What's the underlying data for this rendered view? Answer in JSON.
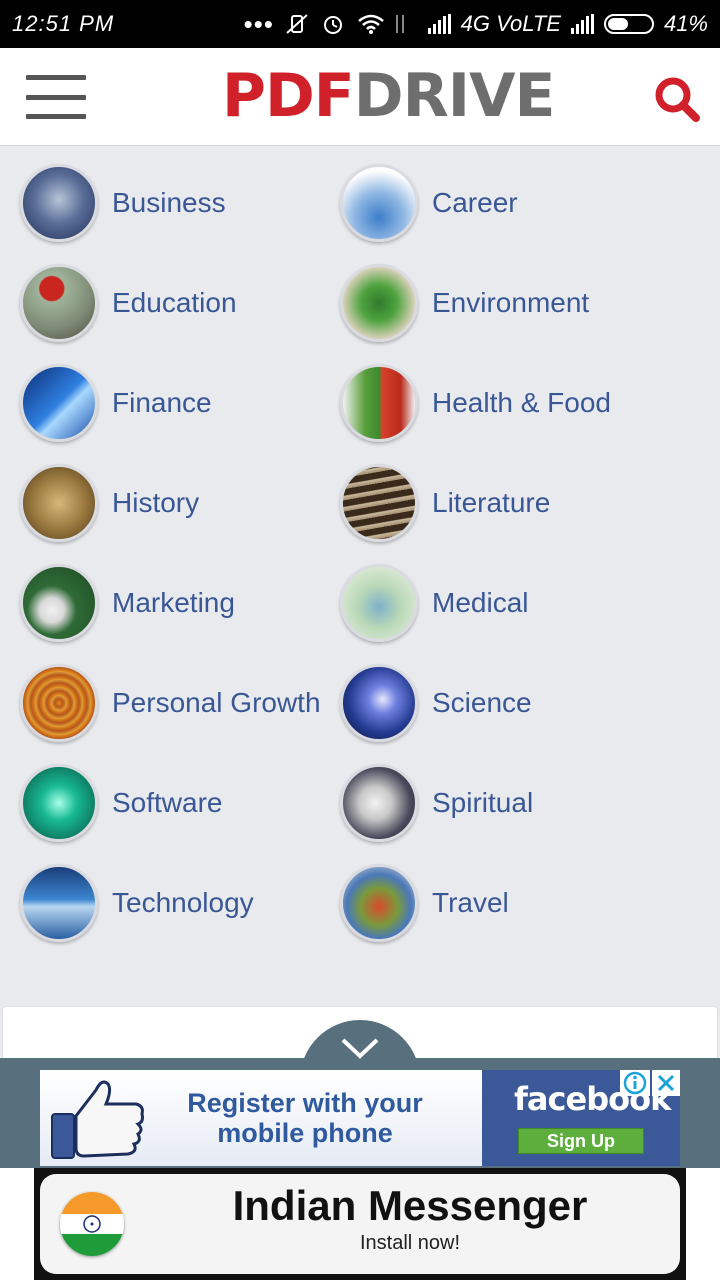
{
  "status_bar": {
    "time": "12:51 PM",
    "network": "4G VoLTE",
    "battery": "41%"
  },
  "header": {
    "logo_part1": "PDF",
    "logo_part2": "DRIVE",
    "menu_icon": "hamburger-menu-icon",
    "search_icon": "search-icon",
    "logo_red": "#d0202a",
    "logo_gray": "#6e6e6e"
  },
  "categories": [
    {
      "label": "Business"
    },
    {
      "label": "Career"
    },
    {
      "label": "Education"
    },
    {
      "label": "Environment"
    },
    {
      "label": "Finance"
    },
    {
      "label": "Health & Food"
    },
    {
      "label": "History"
    },
    {
      "label": "Literature"
    },
    {
      "label": "Marketing"
    },
    {
      "label": "Medical"
    },
    {
      "label": "Personal Growth"
    },
    {
      "label": "Science"
    },
    {
      "label": "Software"
    },
    {
      "label": "Spiritual"
    },
    {
      "label": "Technology"
    },
    {
      "label": "Travel"
    }
  ],
  "ad": {
    "text": "Register with your mobile phone",
    "brand": "facebook",
    "cta": "Sign Up",
    "info_icon": "info-icon",
    "close_icon": "close-icon",
    "collapse_icon": "chevron-down-icon"
  },
  "banner": {
    "title": "Indian Messenger",
    "subtitle": "Install now!"
  },
  "colors": {
    "link": "#3a5795",
    "ad_bar": "#58707d",
    "facebook_blue": "#3b5998"
  }
}
